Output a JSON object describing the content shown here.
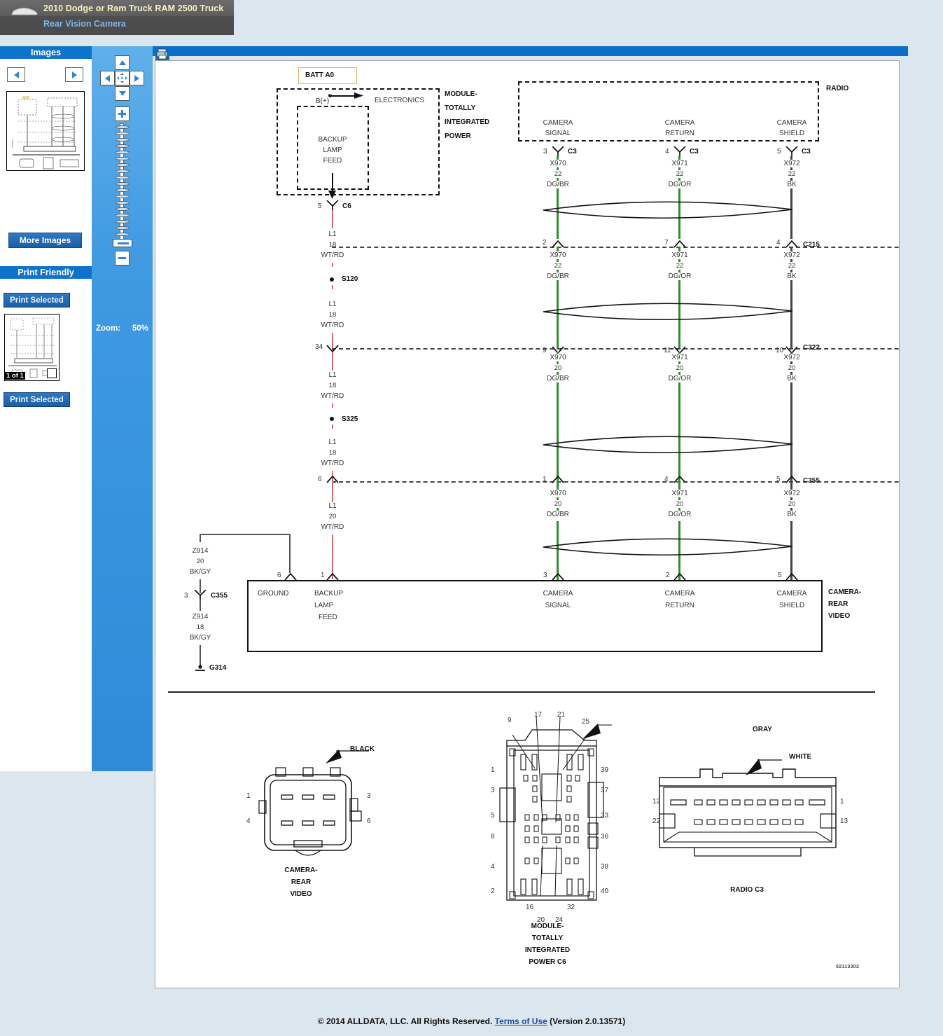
{
  "titlebar": {
    "vehicle": "2010 Dodge or Ram Truck RAM 2500 Truck",
    "subject": "Rear Vision Camera",
    "car_icon": "car-icon"
  },
  "sidebar": {
    "images_header": "Images",
    "prev_label": "",
    "next_label": "",
    "more_images_label": "More Images",
    "print_friendly_header": "Print Friendly",
    "print_selected_top_label": "Print Selected",
    "print_selected_bottom_label": "Print Selected",
    "page_count_badge": "1 of 1"
  },
  "zoomtool": {
    "zoom_label": "Zoom:",
    "zoom_value": "50%",
    "pan_up": "up-arrow-icon",
    "pan_down": "down-arrow-icon",
    "pan_left": "left-arrow-icon",
    "pan_right": "right-arrow-icon",
    "pan_center": "move-icon",
    "zoom_in": "plus-icon",
    "zoom_out": "minus-icon"
  },
  "toolbar": {
    "print_icon": "printer-icon"
  },
  "footer": {
    "copyright": "© 2014 ALLDATA, LLC. All Rights Reserved.",
    "terms": "Terms of Use",
    "version": "(Version 2.0.13571)"
  },
  "diagram": {
    "code": "02113302",
    "batt_label": "BATT A0",
    "module_tip": [
      "MODULE-",
      "TOTALLY",
      "INTEGRATED",
      "POWER"
    ],
    "electronics_label": "ELECTRONICS",
    "b_plus_label": "B(+)",
    "backup_lamp_feed": [
      "BACKUP",
      "LAMP",
      "FEED"
    ],
    "radio_label": "RADIO",
    "radio_pins": [
      {
        "name": [
          "CAMERA",
          "SIGNAL"
        ],
        "pin": "3",
        "conn": "C3"
      },
      {
        "name": [
          "CAMERA",
          "RETURN"
        ],
        "pin": "4",
        "conn": "C3"
      },
      {
        "name": [
          "CAMERA",
          "SHIELD"
        ],
        "pin": "5",
        "conn": "C3"
      }
    ],
    "left_branch": {
      "c6_pin": "5",
      "c6_conn": "C6",
      "seg1": [
        "L1",
        "18",
        "WT/RD"
      ],
      "splice1": "S120",
      "seg2": [
        "L1",
        "18",
        "WT/RD"
      ],
      "c322_pin": "34",
      "seg3": [
        "L1",
        "18",
        "WT/RD"
      ],
      "splice2": "S325",
      "seg4": [
        "L1",
        "18",
        "WT/RD"
      ],
      "c355_pin": "6",
      "seg5": [
        "L1",
        "20",
        "WT/RD"
      ]
    },
    "ground_branch": {
      "seg1": [
        "Z914",
        "20",
        "BK/GY"
      ],
      "c355_pin": "3",
      "c355_conn": "C355",
      "seg2": [
        "Z914",
        "18",
        "BK/GY"
      ],
      "ground_id": "G314",
      "camera_pin": "6"
    },
    "camera_columns": [
      {
        "circuit": "X970",
        "color": "DG/BR",
        "gauges": [
          "22",
          "22",
          "20",
          "20"
        ],
        "pins": {
          "c3": "3",
          "c215": "2",
          "c322": "9",
          "c355": "1",
          "module": "3"
        },
        "module_label": [
          "CAMERA",
          "SIGNAL"
        ]
      },
      {
        "circuit": "X971",
        "color": "DG/OR",
        "gauges": [
          "22",
          "22",
          "20",
          "20"
        ],
        "pins": {
          "c3": "4",
          "c215": "7",
          "c322": "11",
          "c355": "4",
          "module": "2"
        },
        "module_label": [
          "CAMERA",
          "RETURN"
        ]
      },
      {
        "circuit": "X972",
        "color": "BK",
        "gauges": [
          "22",
          "22",
          "20",
          "20"
        ],
        "pins": {
          "c3": "5",
          "c215": "4",
          "c322": "10",
          "c355": "5",
          "module": "5"
        },
        "module_label": [
          "CAMERA",
          "SHIELD"
        ]
      }
    ],
    "connectors_inline": {
      "c215": "C215",
      "c322": "C322",
      "c355": "C355"
    },
    "camera_module": {
      "tip": [
        "CAMERA-",
        "REAR",
        "VIDEO"
      ],
      "ground_label": "GROUND",
      "backup_label": [
        "BACKUP",
        "LAMP",
        "FEED"
      ],
      "backup_pin": "1"
    },
    "pinout_camera": {
      "title": [
        "CAMERA-",
        "REAR",
        "VIDEO"
      ],
      "color_label": "BLACK",
      "left_top": "1",
      "left_bottom": "4",
      "right_top": "3",
      "right_bottom": "6"
    },
    "pinout_module": {
      "title": [
        "MODULE-",
        "TOTALLY",
        "INTEGRATED",
        "POWER C6"
      ],
      "color_label": "GRAY",
      "left_nums": [
        "1",
        "3",
        "5",
        "8",
        "4",
        "2"
      ],
      "right_nums": [
        "39",
        "37",
        "33",
        "36",
        "38",
        "40"
      ],
      "top_nums": [
        "9",
        "17",
        "21",
        "25"
      ],
      "bottom_nums": [
        "16",
        "20",
        "24",
        "32"
      ]
    },
    "pinout_radio": {
      "title": "RADIO C3",
      "color_label": "WHITE",
      "left_top": "12",
      "left_bottom": "22",
      "right_top": "1",
      "right_bottom": "13"
    }
  }
}
